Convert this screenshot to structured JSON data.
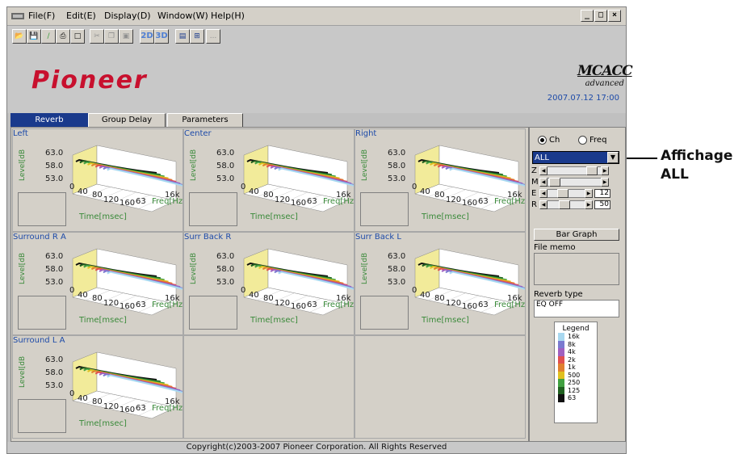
{
  "menubar": {
    "items": [
      "File(F)",
      "Edit(E)",
      "Display(D)",
      "Window(W)",
      "Help(H)"
    ],
    "window_buttons": [
      "_",
      "□",
      "×"
    ]
  },
  "toolbar": {
    "buttons": [
      {
        "icon": "open-icon",
        "glyph": "📂"
      },
      {
        "icon": "save-icon",
        "glyph": "💾"
      },
      {
        "icon": "pen-icon",
        "glyph": "∕"
      },
      {
        "icon": "print-icon",
        "glyph": "⎙"
      },
      {
        "icon": "preview-icon",
        "glyph": "□"
      },
      {
        "icon": "cut-icon",
        "glyph": "✂"
      },
      {
        "icon": "copy-icon",
        "glyph": "❐"
      },
      {
        "icon": "paste-icon",
        "glyph": "▣"
      },
      {
        "label": "2D"
      },
      {
        "label": "3D"
      },
      {
        "icon": "cascade-icon",
        "glyph": "▤"
      },
      {
        "icon": "tile-icon",
        "glyph": "⊞"
      },
      {
        "label": "..."
      }
    ]
  },
  "banner": {
    "brand": "Pioneer",
    "product_logo": "MCACC",
    "product_sub": "advanced",
    "datetime": "2007.07.12 17:00"
  },
  "tabs": [
    "Reverb",
    "Group Delay",
    "Parameters"
  ],
  "active_tab": "Reverb",
  "charts": [
    {
      "title": "Left"
    },
    {
      "title": "Center"
    },
    {
      "title": "Right"
    },
    {
      "title": "Surround R A"
    },
    {
      "title": "Surr Back R"
    },
    {
      "title": "Surr Back L"
    },
    {
      "title": "Surround L A"
    }
  ],
  "chart_common": {
    "ylabel": "Level[dB",
    "yticks": [
      "63.0",
      "58.0",
      "53.0"
    ],
    "xticks": [
      "0",
      "40",
      "80",
      "120",
      "160"
    ],
    "ztick_start": "63",
    "ztick_end": "16k",
    "zlabel": "Freq[Hz",
    "xlabel": "Time[msec]"
  },
  "side_panel": {
    "radio_ch": "Ch",
    "radio_freq": "Freq",
    "selected_radio": "Ch",
    "select_value": "ALL",
    "sliders": [
      {
        "label": "Z",
        "value": null
      },
      {
        "label": "M",
        "value": null
      },
      {
        "label": "E",
        "value": "12"
      },
      {
        "label": "R",
        "value": "50"
      }
    ],
    "bar_graph_button": "Bar Graph",
    "file_memo_label": "File memo",
    "reverb_type_label": "Reverb type",
    "reverb_type_value": "EQ OFF",
    "legend_title": "Legend",
    "legend": [
      {
        "label": "16k",
        "color": "#a8d8f0"
      },
      {
        "label": "8k",
        "color": "#7a7ad0"
      },
      {
        "label": "4k",
        "color": "#a060c0"
      },
      {
        "label": "2k",
        "color": "#e05050"
      },
      {
        "label": "1k",
        "color": "#e08030"
      },
      {
        "label": "500",
        "color": "#e0c020"
      },
      {
        "label": "250",
        "color": "#40a040"
      },
      {
        "label": "125",
        "color": "#206020"
      },
      {
        "label": "63",
        "color": "#101010"
      }
    ]
  },
  "status": "Copyright(c)2003-2007 Pioneer Corporation. All Rights Reserved",
  "callout": {
    "line1": "Affichage",
    "line2": "ALL"
  }
}
